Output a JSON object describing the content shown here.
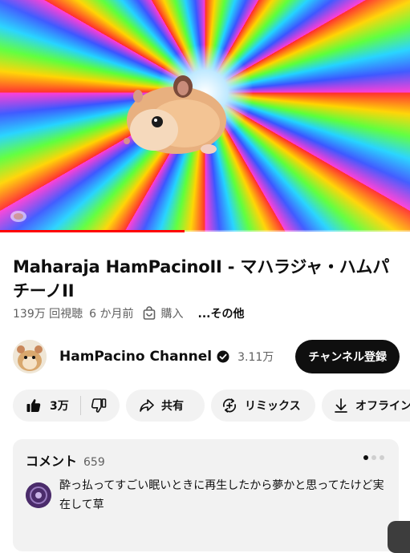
{
  "video": {
    "progress_fraction": 0.45
  },
  "title": "Maharaja HamPacinoII - マハラジャ・ハムパチーノII",
  "meta": {
    "views": "139万 回視聴",
    "age": "6 か月前",
    "buy_label": "購入",
    "more_label": "...その他"
  },
  "channel": {
    "name": "HamPacino Channel",
    "subscribers": "3.11万",
    "subscribe_label": "チャンネル登録"
  },
  "actions": {
    "like_count": "3万",
    "share_label": "共有",
    "remix_label": "リミックス",
    "offline_label": "オフライン"
  },
  "comments": {
    "title": "コメント",
    "count": "659",
    "top_comment": "酔っ払ってすごい眠いときに再生したから夢かと思ってたけど実在して草"
  },
  "colors": {
    "accent": "#ff0000",
    "button_dark": "#0f0f0f",
    "pill_bg": "#f2f2f2",
    "muted_text": "#606060"
  },
  "icons": [
    "like-icon",
    "dislike-icon",
    "share-icon",
    "remix-icon",
    "download-icon",
    "shopping-bag-icon",
    "verified-icon"
  ]
}
